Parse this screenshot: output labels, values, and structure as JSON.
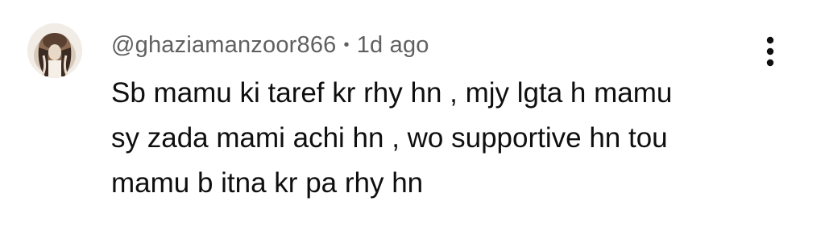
{
  "comment": {
    "author": "@ghaziamanzoor866",
    "separator": "•",
    "timestamp": "1d ago",
    "text_lines": [
      "Sb mamu ki taref kr rhy hn , mjy lgta h mamu",
      "sy zada mami achi hn , wo supportive hn tou",
      "mamu b itna kr pa rhy hn"
    ],
    "avatar_icon": "user-avatar-image",
    "menu_icon": "more-vertical-icon"
  },
  "colors": {
    "background": "#ffffff",
    "meta_text": "#606060",
    "body_text": "#0f0f0f",
    "menu_icon": "#0f0f0f"
  }
}
